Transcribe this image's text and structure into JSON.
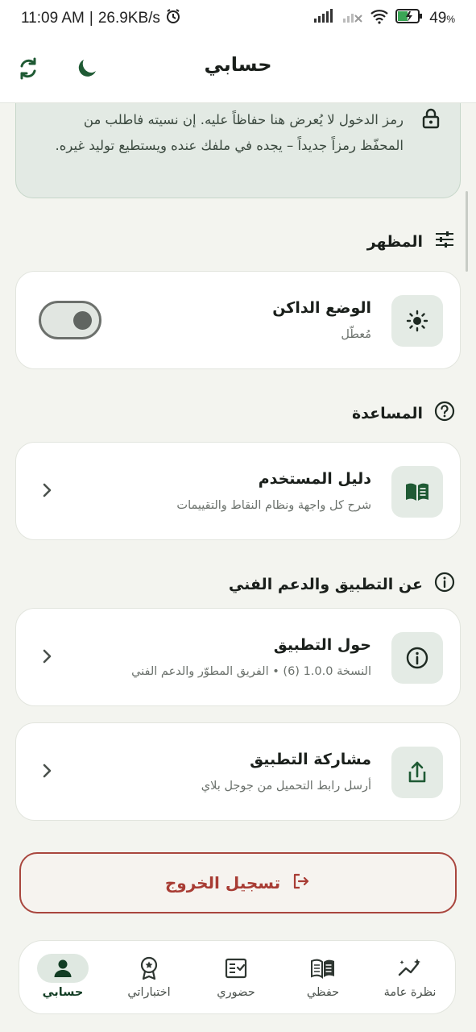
{
  "status": {
    "time": "11:09 AM",
    "speed": "26.9KB/s",
    "battery": "49"
  },
  "header": {
    "title": "حسابي"
  },
  "info": {
    "text": "رمز الدخول لا يُعرض هنا حفاظاً عليه. إن نسيته فاطلب من المحفّظ رمزاً جديداً – يجده في ملفك عنده ويستطيع توليد غيره."
  },
  "sections": {
    "appearance": "المظهر",
    "help": "المساعدة",
    "about": "عن التطبيق والدعم الفني"
  },
  "cards": {
    "dark_mode": {
      "title": "الوضع الداكن",
      "subtitle": "مُعطّل",
      "enabled": false
    },
    "guide": {
      "title": "دليل المستخدم",
      "subtitle": "شرح كل واجهة ونظام النقاط والتقييمات"
    },
    "about_app": {
      "title": "حول التطبيق",
      "subtitle": "النسخة 1.0.0 (6) • الفريق المطوّر والدعم الفني"
    },
    "share": {
      "title": "مشاركة التطبيق",
      "subtitle": "أرسل رابط التحميل من جوجل بلاي"
    }
  },
  "logout": {
    "label": "تسجيل الخروج"
  },
  "nav": {
    "items": [
      {
        "label": "نظرة عامة",
        "icon": "sparkle-chart-icon"
      },
      {
        "label": "حفظي",
        "icon": "book-icon"
      },
      {
        "label": "حضوري",
        "icon": "checklist-icon"
      },
      {
        "label": "اختباراتي",
        "icon": "award-icon"
      },
      {
        "label": "حسابي",
        "icon": "person-icon",
        "active": true
      }
    ]
  },
  "colors": {
    "accent": "#1f5a34",
    "danger": "#a83c34",
    "background": "#f3f4ef"
  }
}
